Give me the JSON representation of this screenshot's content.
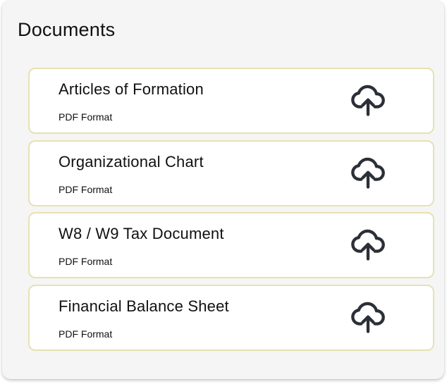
{
  "panel": {
    "title": "Documents"
  },
  "documents": [
    {
      "name": "Articles of Formation",
      "format": "PDF Format",
      "action_icon": "cloud-upload-icon"
    },
    {
      "name": "Organizational Chart",
      "format": "PDF Format",
      "action_icon": "cloud-upload-icon"
    },
    {
      "name": "W8 / W9 Tax Document",
      "format": "PDF Format",
      "action_icon": "cloud-upload-icon"
    },
    {
      "name": "Financial Balance Sheet",
      "format": "PDF Format",
      "action_icon": "cloud-upload-icon"
    }
  ],
  "colors": {
    "panel_background": "#f5f5f5",
    "card_border": "#e7e1b2",
    "card_background": "#ffffff",
    "icon": "#2b2f36",
    "text": "#111111"
  }
}
